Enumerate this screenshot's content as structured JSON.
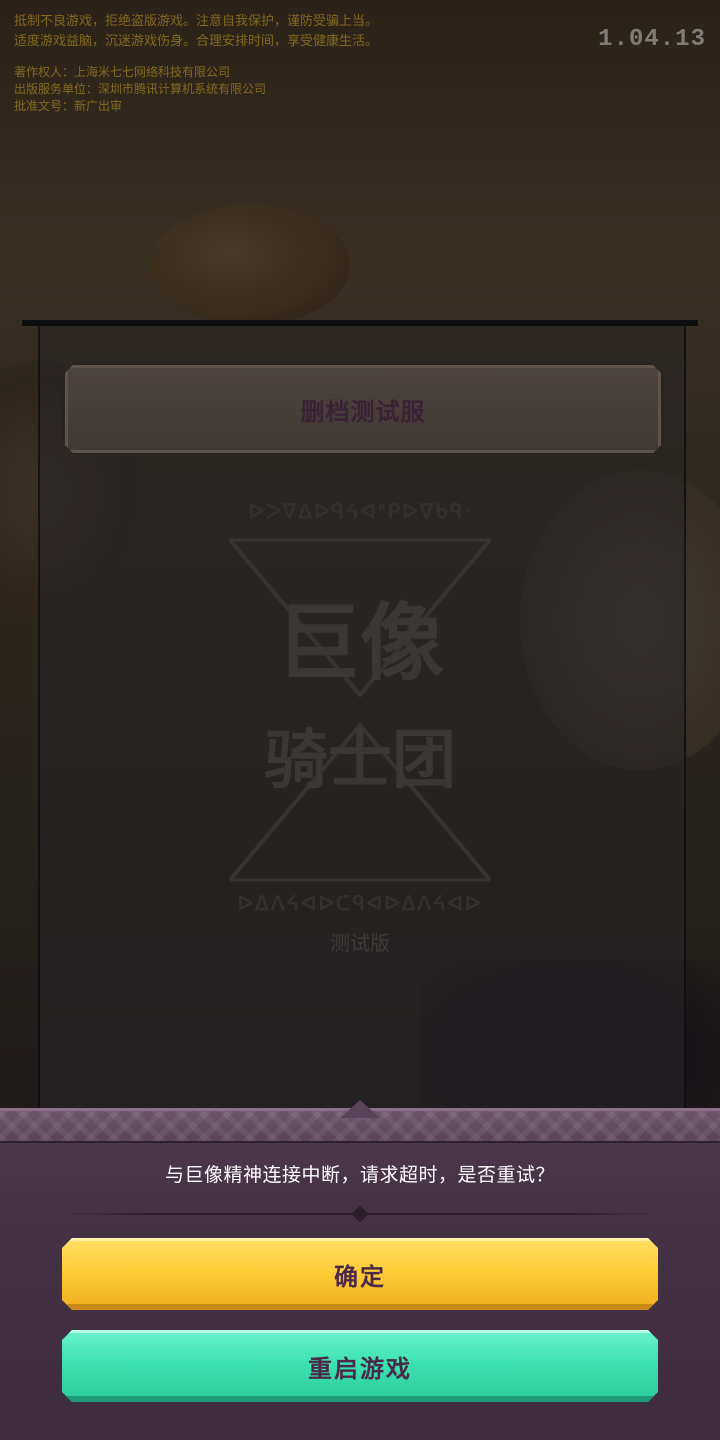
{
  "notice": {
    "lines": [
      "抵制不良游戏，拒绝盗版游戏。注意自我保护，谨防受骗上当。",
      "适度游戏益脑，沉迷游戏伤身。合理安排时间，享受健康生活。"
    ],
    "publisher_lines": [
      "著作权人：上海米七七网络科技有限公司",
      "出版服务单位：深圳市腾讯计算机系统有限公司",
      "批准文号：新广出审"
    ]
  },
  "version": "1.04.13",
  "server": {
    "label": "删档测试服"
  },
  "logo": {
    "rune_top": "ᐅᐳᐁᐃᐅᑫᔦᐊᐢᑭᐅᐁᑲᑫᐧ",
    "line1": "巨像",
    "line2": "骑士团",
    "rune_bottom": "ᐅᐃᐱᔦᐊᐅᑕᑫᐊᐅᐃᐱᔦᐊᐅ",
    "sub": "测试版"
  },
  "dialog": {
    "message": "与巨像精神连接中断，请求超时，是否重试？",
    "confirm_label": "确定",
    "restart_label": "重启游戏"
  },
  "colors": {
    "confirm_button": "#ffcd38",
    "restart_button": "#3ee2b0",
    "dialog_bg": "#453245",
    "button_text": "#4a2a48"
  }
}
